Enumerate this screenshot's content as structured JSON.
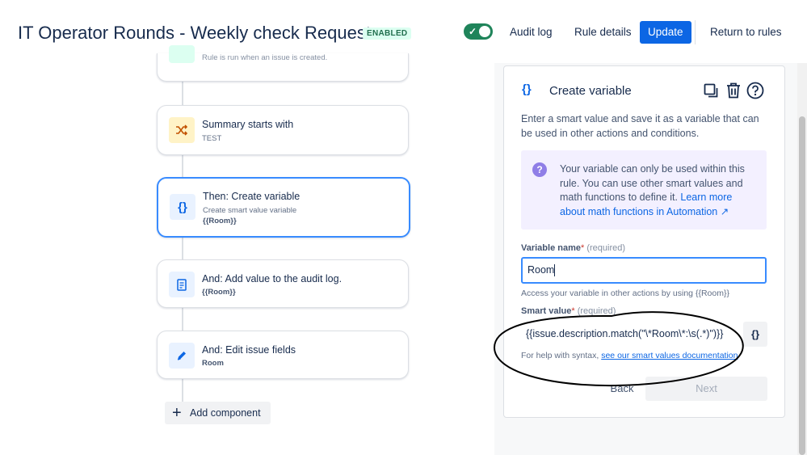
{
  "header": {
    "title": "IT Operator Rounds - Weekly check Requests",
    "status_badge": "ENABLED",
    "audit_log": "Audit log",
    "rule_details": "Rule details",
    "update": "Update",
    "return_to_rules": "Return to rules"
  },
  "flow": {
    "trigger_desc": "Rule is run when an issue is created.",
    "cards": [
      {
        "title": "Summary starts with",
        "subtitle": "TEST"
      },
      {
        "title": "Then: Create variable",
        "subtitle": "Create smart value variable",
        "value": "{{Room}}"
      },
      {
        "title": "And: Add value to the audit log.",
        "value": "{{Room}}"
      },
      {
        "title": "And: Edit issue fields",
        "value": "Room"
      }
    ],
    "add_component": "Add component"
  },
  "panel": {
    "icon_text": "{}",
    "title": "Create variable",
    "description": "Enter a smart value and save it as a variable that can be used in other actions and conditions.",
    "info_text": "Your variable can only be used within this rule. You can use other smart values and math functions to define it.",
    "info_link": "Learn more about math functions in Automation ↗",
    "variable_name_label": "Variable name",
    "required_mark": "*",
    "required_text": "(required)",
    "variable_name_value": "Room",
    "variable_help": "Access your variable in other actions by using {{Room}}",
    "smart_value_label": "Smart value",
    "smart_value": "{{issue.description.match(\"\\*Room\\*:\\s(.*)\")}}",
    "smart_value_btn": "{}",
    "syntax_help": "For help with syntax,",
    "syntax_link": "see our smart values documentation",
    "back": "Back",
    "next": "Next"
  },
  "colors": {
    "primary": "#0c66e4",
    "toggle_on": "#1f845a",
    "selected_border": "#388bff"
  }
}
